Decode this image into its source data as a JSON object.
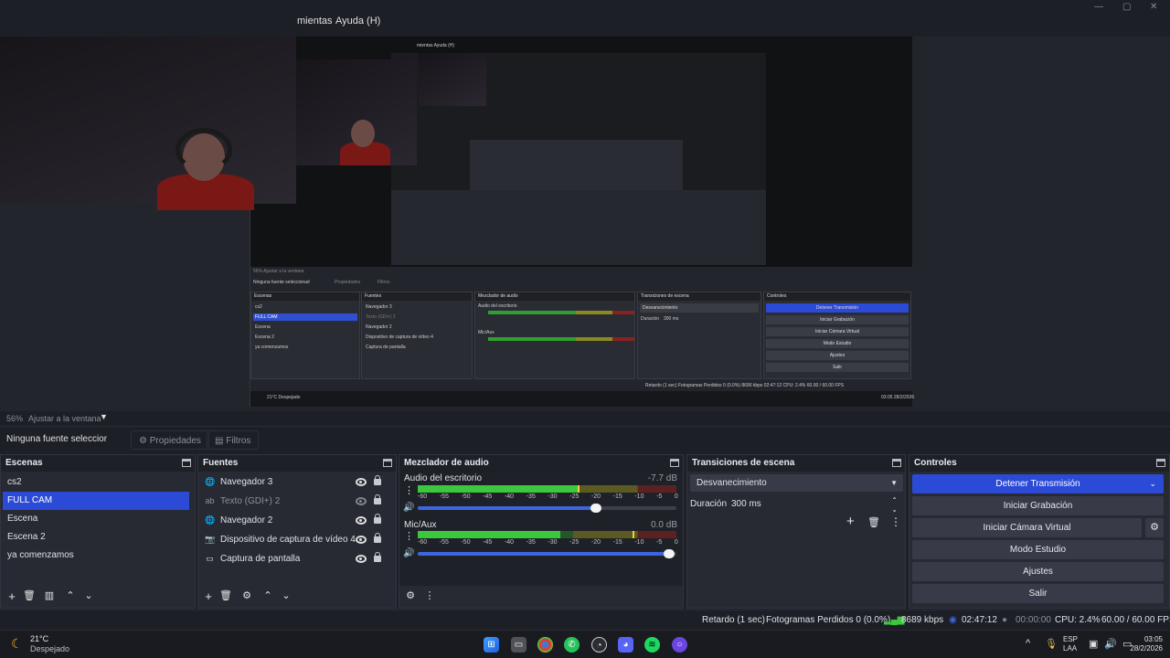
{
  "menubar": {
    "menus": [
      "mientas",
      "Ayuda (H)"
    ],
    "window_controls": [
      "—",
      "▢",
      "✕"
    ]
  },
  "preview": {
    "nested": {
      "menus": "mientas   Ayuda (H)",
      "zoom": "56%   Ajustar a la ventana",
      "no_source": "Ninguna fuente seleccionad",
      "properties": "Propiedades",
      "filters": "Filtros",
      "scenes_title": "Escenas",
      "sources_title": "Fuentes",
      "mixer_title": "Mezclador de audio",
      "transitions_title": "Transiciones de escena",
      "controls_title": "Controles",
      "scenes": [
        "cs2",
        "FULL CAM",
        "Escena",
        "Escena 2",
        "ya comenzamos"
      ],
      "sources": [
        "Navegador 3",
        "Texto (GDI+) 2",
        "Navegador 2",
        "Dispositivo de captura de vídeo 4",
        "Captura de pantalla"
      ],
      "desktop_audio": "Audio del escritorio",
      "mic": "Mic/Aux",
      "transition": "Desvanecimiento",
      "duration_label": "Duración",
      "duration": "300 ms",
      "controls": [
        "Detener Transmisión",
        "Iniciar Grabación",
        "Iniciar Cámara Virtual",
        "Modo Estudio",
        "Ajustes",
        "Salir"
      ],
      "status": "Retardo (1 sec)   Fotogramas Perdidos 0 (0.0%)   8690 kbps   02:47:12   CPU: 2.4%   60.00 / 60.00 FPS",
      "weather": "21°C Despejado",
      "clock": "03:05 28/2/2026"
    }
  },
  "zoom": {
    "percent": "56%",
    "fit_label": "Ajustar a la ventana"
  },
  "properties_bar": {
    "no_source": "Ninguna fuente seleccionad",
    "properties": "Propiedades",
    "filters": "Filtros"
  },
  "scenes": {
    "title": "Escenas",
    "items": [
      "cs2",
      "FULL CAM",
      "Escena",
      "Escena 2",
      "ya comenzamos"
    ],
    "selected_index": 1
  },
  "sources": {
    "title": "Fuentes",
    "items": [
      {
        "name": "Navegador 3",
        "icon": "globe-icon",
        "visible": true
      },
      {
        "name": "Texto (GDI+) 2",
        "icon": "text-icon",
        "visible": false
      },
      {
        "name": "Navegador 2",
        "icon": "globe-icon",
        "visible": true
      },
      {
        "name": "Dispositivo de captura de vídeo 4",
        "icon": "camera-icon",
        "visible": true
      },
      {
        "name": "Captura de pantalla",
        "icon": "monitor-icon",
        "visible": true
      }
    ]
  },
  "mixer": {
    "title": "Mezclador de audio",
    "ticks": [
      "-60",
      "-55",
      "-50",
      "-45",
      "-40",
      "-35",
      "-30",
      "-25",
      "-20",
      "-15",
      "-10",
      "-5",
      "0"
    ],
    "channels": [
      {
        "name": "Audio del escritorio",
        "db": "-7.7 dB",
        "level": 0.62,
        "peak": 0.62,
        "volume": 0.69
      },
      {
        "name": "Mic/Aux",
        "db": "0.0 dB",
        "level": 0.55,
        "peak": 0.83,
        "volume": 0.97
      }
    ]
  },
  "transitions": {
    "title": "Transiciones de escena",
    "selected": "Desvanecimiento",
    "duration_label": "Duración",
    "duration_value": "300 ms"
  },
  "controls": {
    "title": "Controles",
    "stop_stream": "Detener Transmisión",
    "start_recording": "Iniciar Grabación",
    "start_virtual_cam": "Iniciar Cámara Virtual",
    "studio_mode": "Modo Estudio",
    "settings": "Ajustes",
    "exit": "Salir"
  },
  "status": {
    "delay": "Retardo (1 sec)",
    "dropped_frames": "Fotogramas Perdidos 0 (0.0%)",
    "bitrate": "8689 kbps",
    "stream_time": "02:47:12",
    "record_time": "00:00:00",
    "cpu": "CPU: 2.4%",
    "fps": "60.00 / 60.00 FPS"
  },
  "taskbar": {
    "temperature": "21°C",
    "weather": "Despejado",
    "lang_top": "ESP",
    "lang_bottom": "LAA",
    "time": "03:05",
    "date": "28/2/2026"
  },
  "colors": {
    "accent": "#2b4ad6",
    "meter_green": "#3cc83c",
    "meter_yellow": "#c8b43c",
    "meter_red": "#c83c3c",
    "volume_blue": "#3c66e0"
  }
}
